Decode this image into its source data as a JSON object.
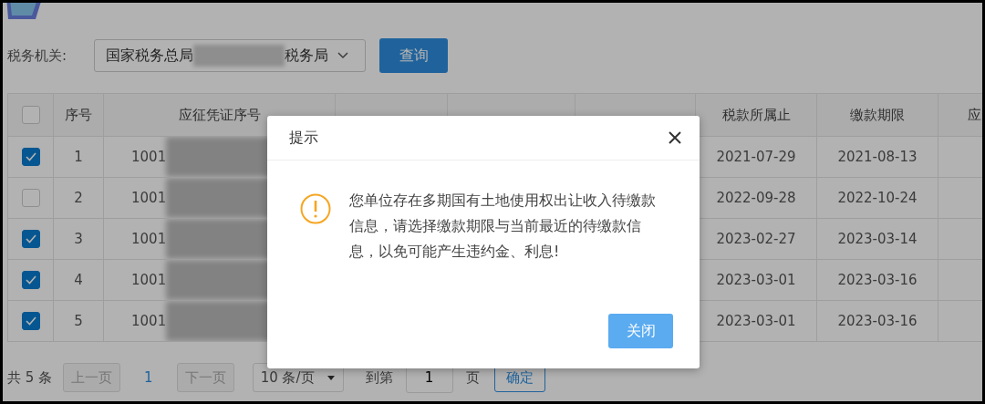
{
  "filter": {
    "label": "税务机关:",
    "select": {
      "value_start": "国家税务总局",
      "value_end": "税务局"
    },
    "query_button": "查询"
  },
  "table": {
    "header_checkbox": {
      "checked": false
    },
    "columns": [
      "序号",
      "应征凭证序号",
      "税款所属止",
      "缴款期限",
      "应"
    ],
    "rows": [
      {
        "checked": true,
        "index": "1",
        "voucher": "1001",
        "period_end": "2021-07-29",
        "deadline": "2021-08-13"
      },
      {
        "checked": false,
        "index": "2",
        "voucher": "1001",
        "period_end": "2022-09-28",
        "deadline": "2022-10-24"
      },
      {
        "checked": true,
        "index": "3",
        "voucher": "1001",
        "period_end": "2023-02-27",
        "deadline": "2023-03-14"
      },
      {
        "checked": true,
        "index": "4",
        "voucher": "1001",
        "period_end": "2023-03-01",
        "deadline": "2023-03-16"
      },
      {
        "checked": true,
        "index": "5",
        "voucher": "1001",
        "period_end": "2023-03-01",
        "deadline": "2023-03-16"
      }
    ]
  },
  "pagination": {
    "total": "共 5 条",
    "prev": "上一页",
    "page": "1",
    "next": "下一页",
    "page_size": "10 条/页",
    "goto_label": "到第",
    "goto_value": "1",
    "goto_unit": "页",
    "confirm": "确定"
  },
  "dialog": {
    "title": "提示",
    "message": "您单位存在多期国有土地使用权出让收入待缴款信息，请选择缴款期限与当前最近的待缴款信息，以免可能产生违约金、利息!",
    "close_button": "关闭"
  }
}
